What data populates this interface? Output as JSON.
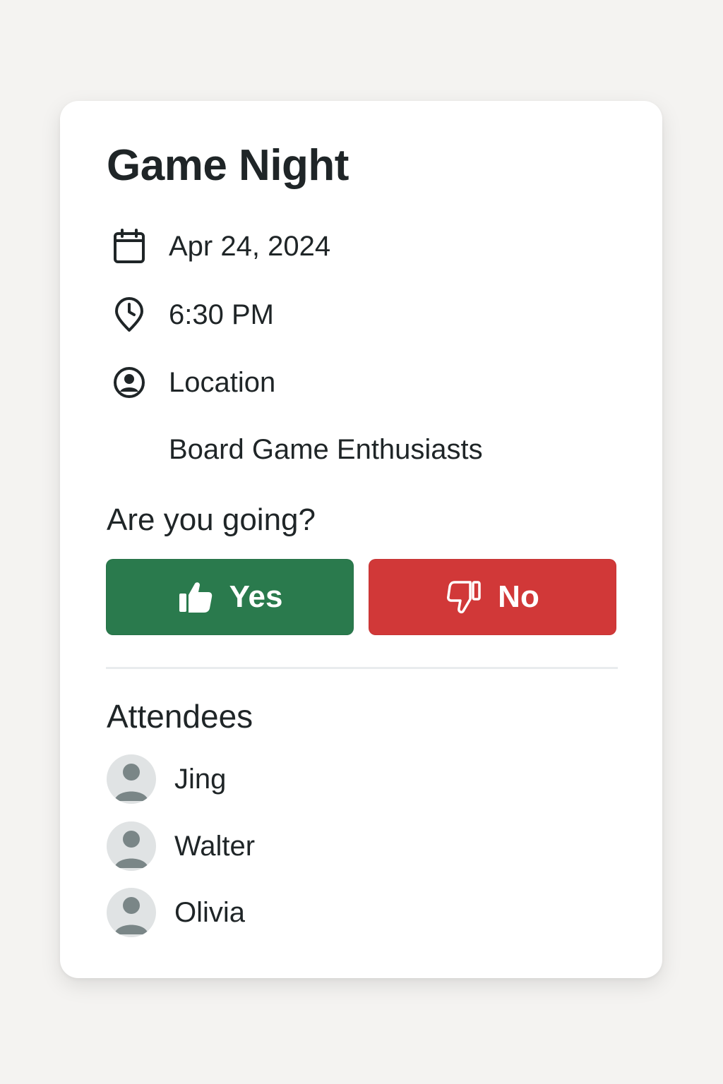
{
  "event": {
    "title": "Game Night",
    "date": "Apr 24, 2024",
    "time": "6:30 PM",
    "location_label": "Location",
    "organizer": "Board Game Enthusiasts"
  },
  "rsvp": {
    "question": "Are you going?",
    "yes_label": "Yes",
    "no_label": "No"
  },
  "attendees": {
    "title": "Attendees",
    "list": [
      {
        "name": "Jing"
      },
      {
        "name": "Walter"
      },
      {
        "name": "Olivia"
      }
    ]
  },
  "icons": {
    "date": "calendar-icon",
    "time": "clock-pin-icon",
    "location": "user-circle-icon",
    "yes": "thumbs-up-icon",
    "no": "thumbs-down-icon",
    "avatar": "avatar-placeholder-icon"
  },
  "colors": {
    "yes": "#2a7a4d",
    "no": "#d13838",
    "background": "#f4f3f1",
    "card": "#ffffff",
    "text": "#1f2527"
  }
}
